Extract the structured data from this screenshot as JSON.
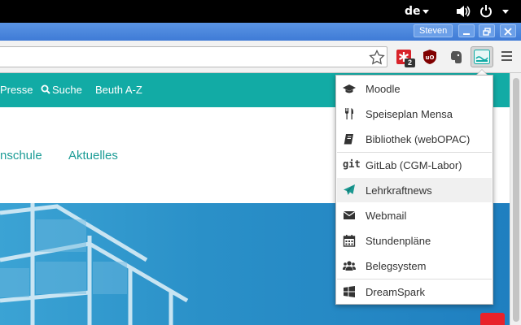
{
  "os_panel": {
    "language": "de"
  },
  "window": {
    "user": "Steven"
  },
  "toolbar": {
    "url_value": "",
    "url_placeholder": ""
  },
  "site": {
    "nav": [
      "Presse",
      "Suche",
      "Beuth A-Z"
    ],
    "subnav": [
      "nschule",
      "Aktuelles"
    ]
  },
  "popup": {
    "items": [
      {
        "label": "Moodle",
        "icon": "graduation-cap-icon"
      },
      {
        "label": "Speiseplan Mensa",
        "icon": "utensils-icon"
      },
      {
        "label": "Bibliothek (webOPAC)",
        "icon": "book-icon"
      },
      {
        "label": "GitLab (CGM-Labor)",
        "icon": "git-icon",
        "icon_text": "git"
      },
      {
        "label": "Lehrkraftnews",
        "icon": "paper-plane-icon"
      },
      {
        "label": "Webmail",
        "icon": "envelope-icon"
      },
      {
        "label": "Stundenpläne",
        "icon": "calendar-icon"
      },
      {
        "label": "Belegsystem",
        "icon": "users-icon"
      },
      {
        "label": "DreamSpark",
        "icon": "windows-icon"
      }
    ]
  },
  "extensions": {
    "badge_count": "2"
  },
  "colors": {
    "teal": "#12aba5",
    "link": "#1c9c96",
    "title_blue": "#4a89de"
  }
}
